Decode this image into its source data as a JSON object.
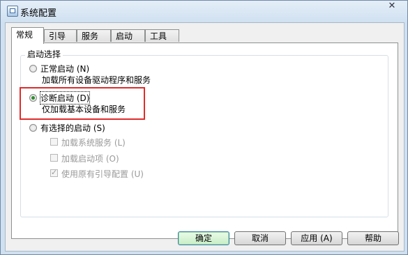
{
  "window": {
    "title": "系统配置"
  },
  "tabs": [
    {
      "label": "常规",
      "active": true
    },
    {
      "label": "引导",
      "active": false
    },
    {
      "label": "服务",
      "active": false
    },
    {
      "label": "启动",
      "active": false
    },
    {
      "label": "工具",
      "active": false
    }
  ],
  "general": {
    "group_label": "启动选择",
    "normal": {
      "label": "正常启动 (N)",
      "desc": "加载所有设备驱动程序和服务",
      "selected": false
    },
    "diagnostic": {
      "label": "诊断启动 (D)",
      "desc": "仅加载基本设备和服务",
      "selected": true
    },
    "selective": {
      "label": "有选择的启动 (S)",
      "selected": false,
      "options": [
        {
          "label": "加载系统服务 (L)",
          "checked": false
        },
        {
          "label": "加载启动项 (O)",
          "checked": false
        },
        {
          "label": "使用原有引导配置 (U)",
          "checked": true
        }
      ]
    }
  },
  "buttons": {
    "ok": "确定",
    "cancel": "取消",
    "apply": "应用 (A)",
    "help": "帮助"
  },
  "colors": {
    "highlight": "#e02b2b",
    "default_button": "#c8eec6"
  }
}
